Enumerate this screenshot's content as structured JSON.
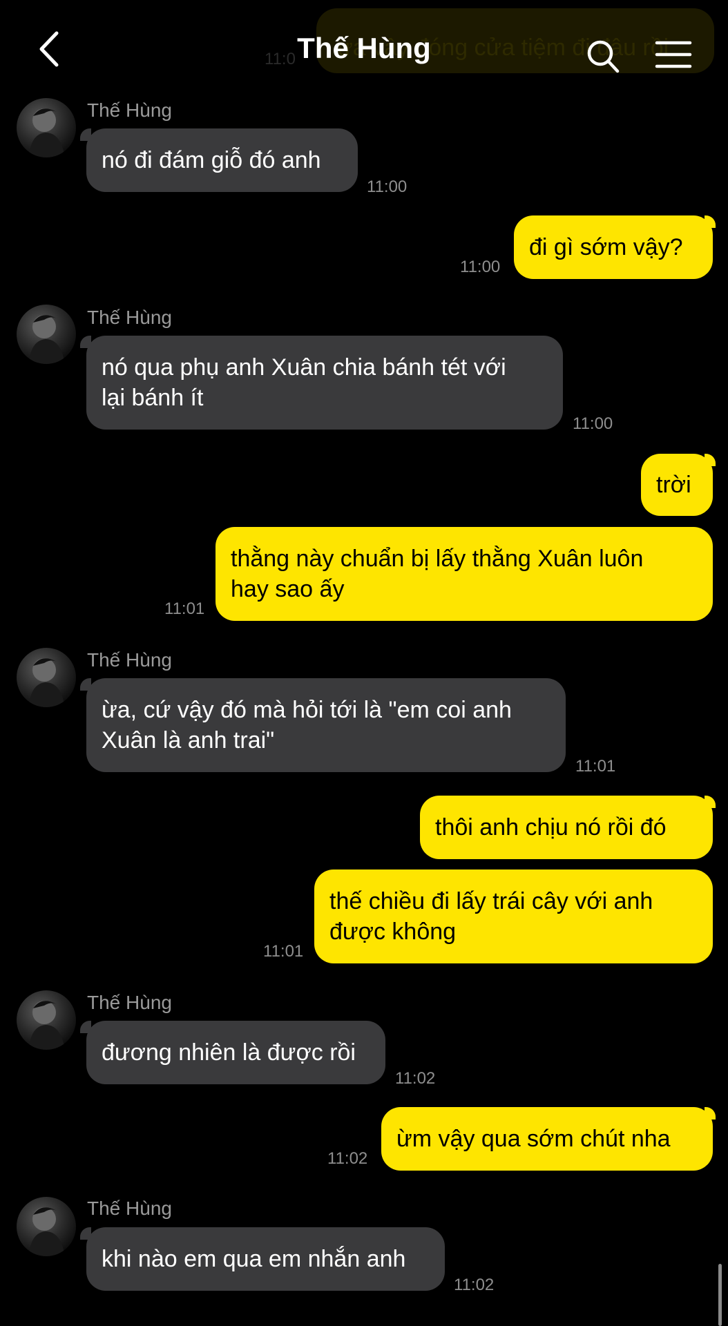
{
  "header": {
    "title": "Thế Hùng"
  },
  "partial_message": {
    "text": "ừa vậy đóng cửa tiệm đi đâu rồi",
    "time": "11:0"
  },
  "messages": [
    {
      "sender": "Thế Hùng",
      "text": "nó đi đám giỗ đó anh",
      "time": "11:00"
    },
    {
      "text": "đi gì sớm vậy?",
      "time": "11:00"
    },
    {
      "sender": "Thế Hùng",
      "line1": "nó qua phụ anh Xuân chia bánh tét với",
      "line2": "lại bánh ít",
      "time": "11:00"
    },
    {
      "text": "trời"
    },
    {
      "line1": "thằng này chuẩn bị lấy thằng Xuân luôn",
      "line2": "hay sao ấy",
      "time": "11:01"
    },
    {
      "sender": "Thế Hùng",
      "line1": "ừa, cứ vậy đó mà hỏi tới là \"em coi anh",
      "line2": "Xuân là anh trai\"",
      "time": "11:01"
    },
    {
      "text": "thôi anh chịu nó rồi đó"
    },
    {
      "line1": "thế chiều đi lấy trái cây với anh",
      "line2": "được không",
      "time": "11:01"
    },
    {
      "sender": "Thế Hùng",
      "text": "đương nhiên là được rồi",
      "time": "11:02"
    },
    {
      "text": "ừm vậy qua sớm chút nha",
      "time": "11:02"
    },
    {
      "sender": "Thế Hùng",
      "text": "khi nào em qua em nhắn anh",
      "time": "11:02"
    }
  ],
  "icons": {
    "back": "chevron-left-icon",
    "search": "search-icon",
    "menu": "hamburger-menu-icon"
  },
  "colors": {
    "background": "#000000",
    "incoming_bubble": "#3a3a3c",
    "outgoing_bubble": "#fee500",
    "timestamp": "#8e8e8e",
    "sender_name": "#9a9a9a"
  }
}
